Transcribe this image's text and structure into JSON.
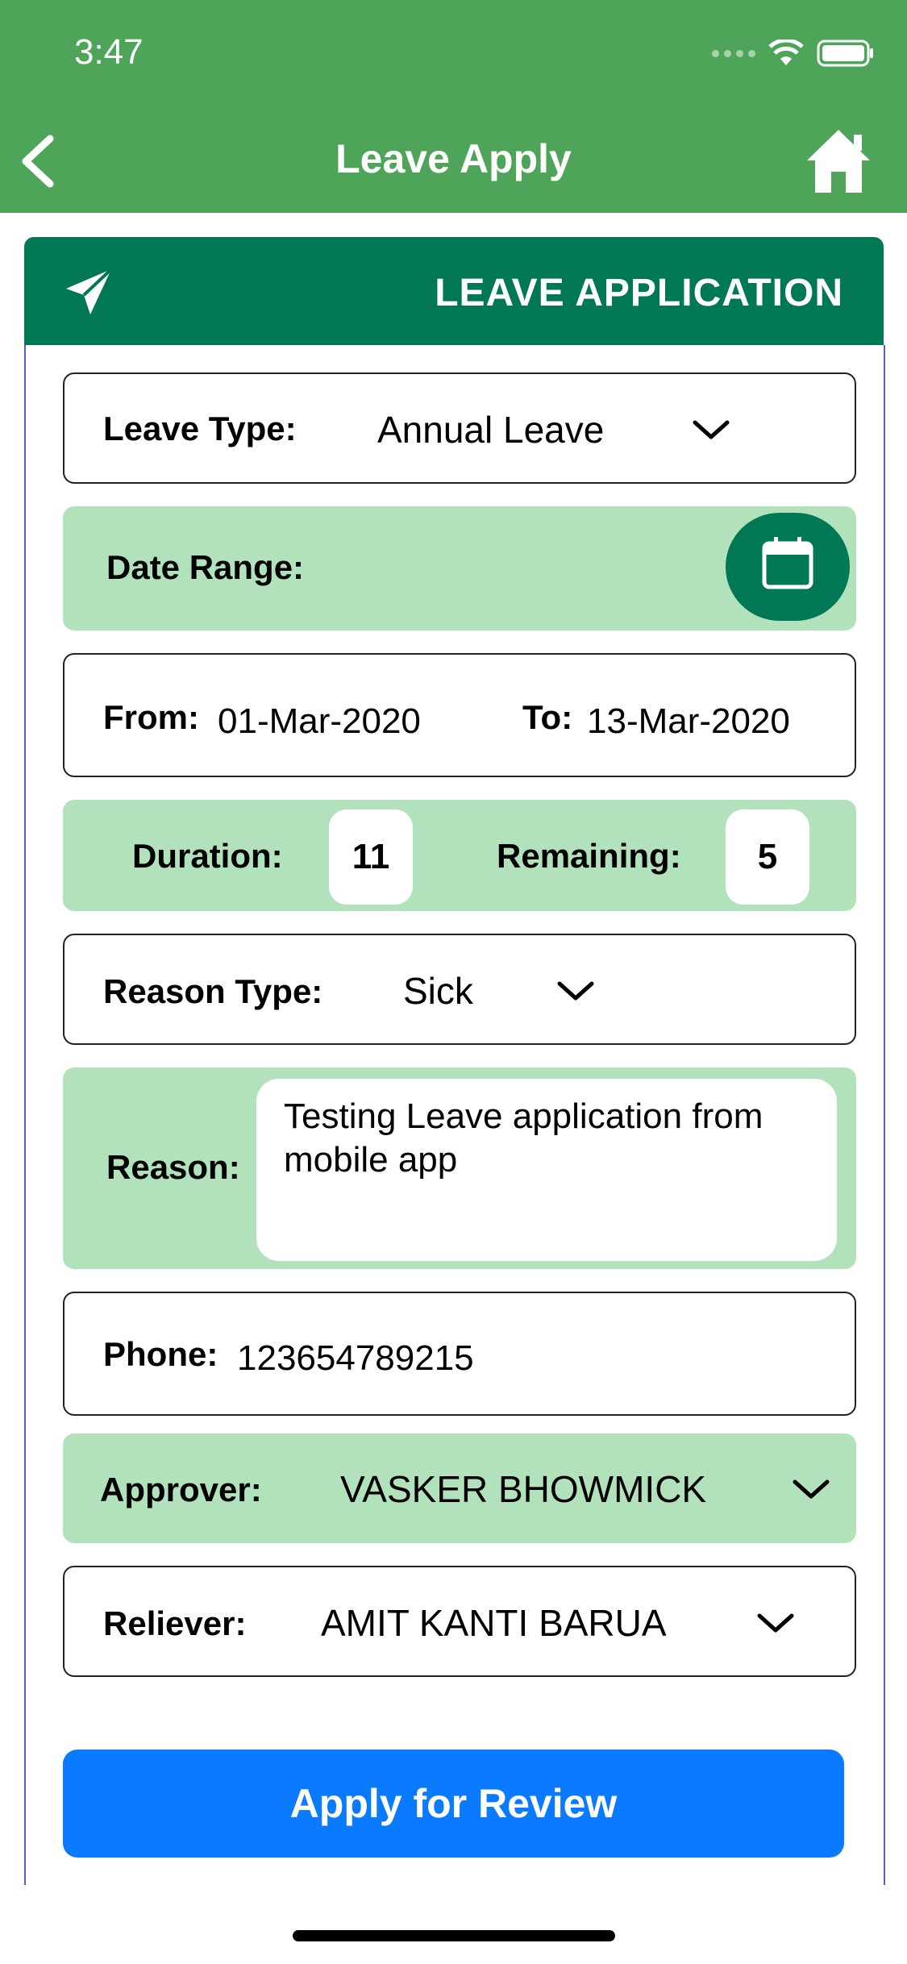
{
  "status": {
    "time": "3:47"
  },
  "nav": {
    "title": "Leave Apply",
    "back_icon": "chevron-left-icon",
    "home_icon": "home-icon"
  },
  "header": {
    "title": "LEAVE APPLICATION",
    "icon": "paper-plane-icon"
  },
  "form": {
    "leave_type": {
      "label": "Leave Type:",
      "value": "Annual Leave"
    },
    "date_range": {
      "label": "Date Range:",
      "icon": "calendar-icon"
    },
    "dates": {
      "from_label": "From:",
      "from_value": "01-Mar-2020",
      "to_label": "To:",
      "to_value": "13-Mar-2020"
    },
    "duration": {
      "label": "Duration:",
      "value": "11",
      "remaining_label": "Remaining:",
      "remaining_value": "5"
    },
    "reason_type": {
      "label": "Reason Type:",
      "value": "Sick"
    },
    "reason": {
      "label": "Reason:",
      "value": "Testing Leave application from mobile app"
    },
    "phone": {
      "label": "Phone:",
      "value": "123654789215"
    },
    "approver": {
      "label": "Approver:",
      "value": "VASKER BHOWMICK"
    },
    "reliever": {
      "label": "Reliever:",
      "value": "AMIT KANTI BARUA"
    }
  },
  "submit_label": "Apply for Review",
  "colors": {
    "nav_green": "#4ea55a",
    "header_green": "#007755",
    "row_green": "#b2e2bb",
    "button_blue": "#0a7aff"
  }
}
